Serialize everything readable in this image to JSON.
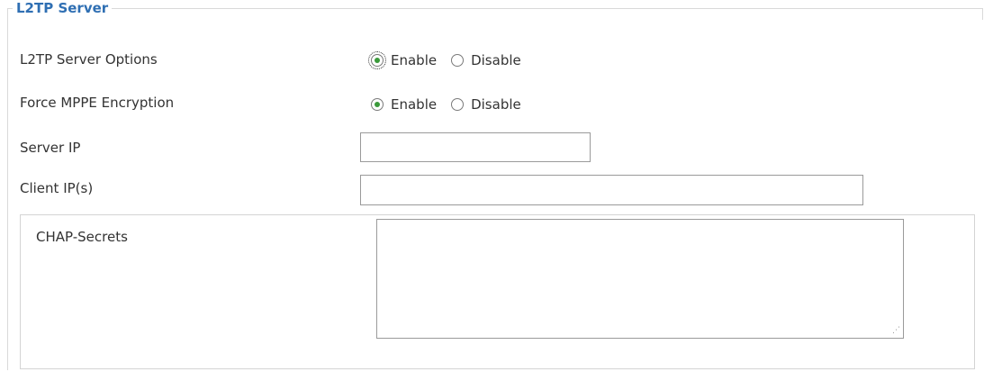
{
  "section": {
    "title": "L2TP Server"
  },
  "rows": {
    "server_options": {
      "label": "L2TP Server Options",
      "enable": "Enable",
      "disable": "Disable",
      "selected": "Enable"
    },
    "force_mppe": {
      "label": "Force MPPE Encryption",
      "enable": "Enable",
      "disable": "Disable",
      "selected": "Enable"
    },
    "server_ip": {
      "label": "Server IP",
      "value": ""
    },
    "client_ips": {
      "label": "Client IP(s)",
      "value": ""
    },
    "chap_secrets": {
      "label": "CHAP-Secrets",
      "value": ""
    }
  },
  "colors": {
    "legend": "#2f6fb3",
    "radio_checked": "#3b9a3b",
    "border": "#d9d9d9"
  }
}
